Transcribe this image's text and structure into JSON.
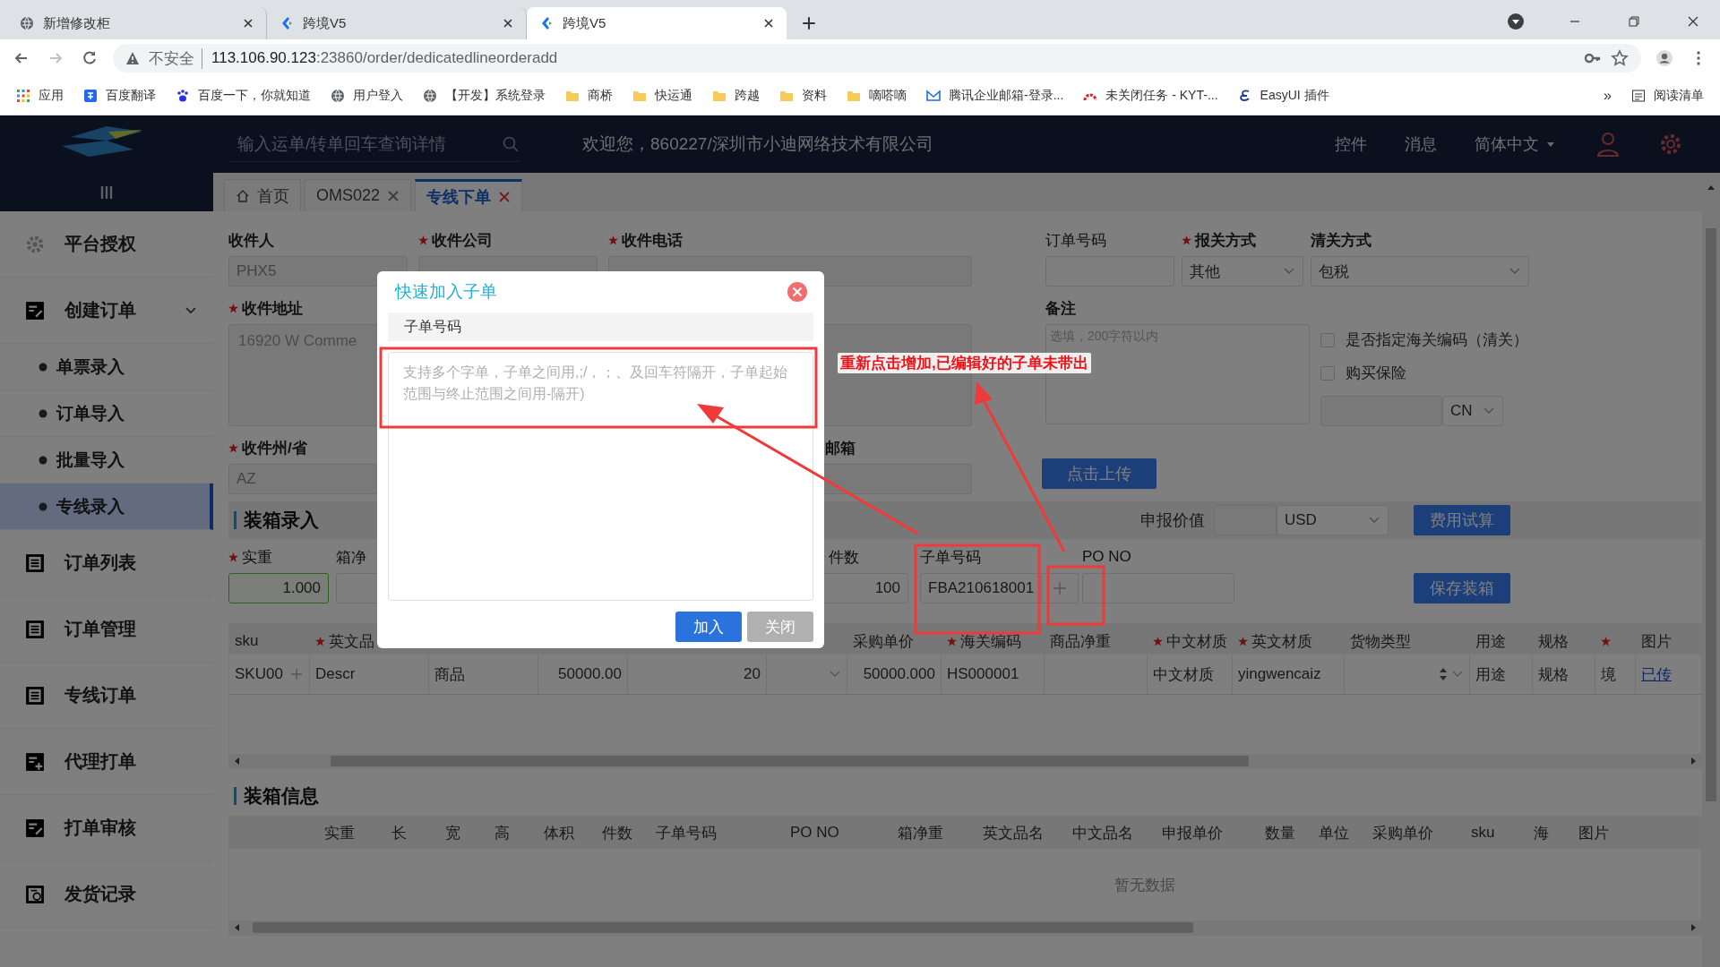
{
  "browser": {
    "tabs": [
      {
        "title": "新增修改柜",
        "selected": false
      },
      {
        "title": "跨境V5",
        "selected": false
      },
      {
        "title": "跨境V5",
        "selected": true
      }
    ],
    "security": "不安全",
    "url_host": "113.106.90.123",
    "url_path": ":23860/order/dedicatedlineorderadd",
    "bookmarks": [
      "应用",
      "百度翻译",
      "百度一下，你就知道",
      "用户登入",
      "【开发】系统登录",
      "商桥",
      "快运通",
      "跨越",
      "资料",
      "嘀嗒嘀",
      "腾讯企业邮箱-登录...",
      "未关闭任务 - KYT-...",
      "EasyUI 插件"
    ],
    "more": "»",
    "reading_list": "阅读清单"
  },
  "header": {
    "search_placeholder": "输入运单/转单回车查询详情",
    "welcome": "欢迎您，860227/深圳市小迪网络技术有限公司",
    "links": [
      "控件",
      "消息"
    ],
    "language": "简体中文"
  },
  "page_tabs": [
    {
      "label": "首页",
      "kind": "home",
      "selected": false
    },
    {
      "label": "OMS022",
      "kind": "closable",
      "selected": false
    },
    {
      "label": "专线下单",
      "kind": "closable",
      "selected": true
    }
  ],
  "sidebar": [
    {
      "label": "平台授权",
      "selected": false
    },
    {
      "label": "创建订单",
      "selected": false,
      "expanded": true,
      "children": [
        {
          "label": "单票录入",
          "selected": false
        },
        {
          "label": "订单导入",
          "selected": false
        },
        {
          "label": "批量导入",
          "selected": false
        },
        {
          "label": "专线录入",
          "selected": true
        }
      ]
    },
    {
      "label": "订单列表",
      "selected": false
    },
    {
      "label": "订单管理",
      "selected": false
    },
    {
      "label": "专线订单",
      "selected": false
    },
    {
      "label": "代理打单",
      "selected": false
    },
    {
      "label": "打单审核",
      "selected": false
    },
    {
      "label": "发货记录",
      "selected": false
    }
  ],
  "receiver": {
    "name": {
      "label": "收件人",
      "required": false,
      "value": "PHX5"
    },
    "company": {
      "label": "收件公司",
      "required": true
    },
    "phone": {
      "label": "收件电话",
      "required": true
    },
    "address": {
      "label": "收件地址",
      "required": true,
      "value": "16920 W Comme"
    },
    "state": {
      "label": "收件州/省",
      "required": true,
      "value": "AZ"
    },
    "email": {
      "label": "邮箱",
      "required": false
    }
  },
  "order": {
    "order_no": {
      "label": "订单号码",
      "required": false
    },
    "declare_mode": {
      "label": "报关方式",
      "required": true,
      "value": "其他"
    },
    "clearance_mode": {
      "label": "清关方式",
      "required": false,
      "value": "包税"
    },
    "remark": {
      "label": "备注",
      "placeholder": "选填，200字符以内"
    },
    "options": [
      {
        "label": "是否指定海关编码（清关）",
        "checked": false
      },
      {
        "label": "购买保险",
        "checked": false
      }
    ],
    "insurance_currency": "CN",
    "upload_button": "点击上传"
  },
  "packing": {
    "title": "装箱录入",
    "declared_value_label": "申报价值",
    "currency": "USD",
    "estimate_button": "费用试算",
    "fields": [
      {
        "label": "实重",
        "required": true,
        "value": "1.000",
        "kind": "number",
        "valid": true
      },
      {
        "label": "箱净",
        "required": false,
        "kind": "number",
        "valid": false
      },
      {
        "label": "件数",
        "required": true,
        "value": "100",
        "kind": "number",
        "valid": false
      },
      {
        "label": "子单号码",
        "required": false,
        "value": "FBA210618001",
        "kind": "sub_no",
        "valid": false
      },
      {
        "label": "PO NO",
        "required": false,
        "kind": "text",
        "valid": false
      }
    ],
    "save_button": "保存装箱"
  },
  "items_table": {
    "columns": [
      {
        "label": "sku",
        "required": false
      },
      {
        "label": "英文品",
        "required": true
      },
      {
        "required": false
      },
      {
        "required": false
      },
      {
        "required": false
      },
      {
        "required": false
      },
      {
        "label": "采购单价",
        "required": false
      },
      {
        "label": "海关编码",
        "required": true
      },
      {
        "label": "商品净重",
        "required": false
      },
      {
        "label": "中文材质",
        "required": true
      },
      {
        "label": "英文材质",
        "required": true
      },
      {
        "label": "货物类型",
        "required": false
      },
      {
        "label": "用途",
        "required": false
      },
      {
        "label": "规格",
        "required": false
      },
      {
        "required": true
      },
      {
        "label": "图片",
        "required": false
      }
    ],
    "rows": [
      {
        "cells": [
          {
            "kind": "add",
            "text": "SKU00"
          },
          {
            "kind": "text",
            "text": "Descr"
          },
          {
            "kind": "text",
            "text": "商品"
          },
          {
            "kind": "number",
            "text": "50000.00"
          },
          {
            "kind": "number",
            "text": "20"
          },
          {
            "kind": "select"
          },
          {
            "kind": "number",
            "text": "50000.000"
          },
          {
            "kind": "text",
            "text": "HS000001"
          },
          {
            "kind": "empty"
          },
          {
            "kind": "text",
            "text": "中文材质"
          },
          {
            "kind": "text",
            "text": "yingwencaiz"
          },
          {
            "kind": "spinner"
          },
          {
            "kind": "text",
            "text": "用途"
          },
          {
            "kind": "text",
            "text": "规格"
          },
          {
            "kind": "text",
            "text": "境"
          },
          {
            "kind": "link",
            "text": "已传"
          }
        ]
      }
    ]
  },
  "packing_info": {
    "title": "装箱信息",
    "columns": [
      "实重",
      "长",
      "宽",
      "高",
      "体积",
      "件数",
      "子单号码",
      "PO NO",
      "箱净重",
      "英文品名",
      "中文品名",
      "申报单价",
      "数量",
      "单位",
      "采购单价",
      "sku",
      "海",
      "图片"
    ],
    "empty_text": "暂无数据"
  },
  "dialog": {
    "title": "快速加入子单",
    "column_header": "子单号码",
    "placeholder": "支持多个字单，子单之间用,;/，；、及回车符隔开，子单起始范围与终止范围之间用-隔开)",
    "buttons": [
      {
        "label": "加入",
        "kind": "primary"
      },
      {
        "label": "关闭",
        "kind": "secondary"
      }
    ]
  },
  "annotation": {
    "note": "重新点击增加,已编辑好的子单未带出"
  }
}
